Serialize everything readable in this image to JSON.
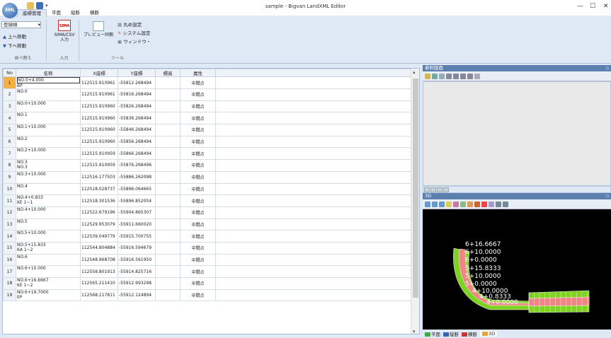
{
  "app": {
    "title": "sample - Bigvan LandXML Editor",
    "logo_text": "XML"
  },
  "menu_tabs": [
    "座標管理",
    "平面",
    "縦断",
    "横断"
  ],
  "ribbon": {
    "sort_combo": "登録順",
    "move_up": "上へ移動",
    "move_down": "下へ移動",
    "group_sort": "並べ替え",
    "sima_icon_text": "SIMA",
    "sima_csv_line1": "SIMA/CSV",
    "sima_csv_line2": "入力",
    "group_input": "入力",
    "preview_sync": "プレビュー同期",
    "circle_settings": "丸め設定",
    "system_settings": "システム設定",
    "window": "ウィンドウ・",
    "group_tools": "ツール"
  },
  "grid": {
    "headers": [
      "No",
      "名称",
      "X座標",
      "Y座標",
      "標高",
      "属性"
    ],
    "rows": [
      {
        "no": "1",
        "name1": "NO.0+4.000",
        "name2": "BP",
        "x": "112515.910961",
        "y": "-55812.268494",
        "z": "",
        "attr": "中間点"
      },
      {
        "no": "2",
        "name1": "NO.0",
        "name2": "",
        "x": "112515.910961",
        "y": "-55816.268494",
        "z": "",
        "attr": "中間点"
      },
      {
        "no": "3",
        "name1": "NO.0+10.000",
        "name2": "",
        "x": "112515.910960",
        "y": "-55826.268494",
        "z": "",
        "attr": "中間点"
      },
      {
        "no": "4",
        "name1": "NO.1",
        "name2": "",
        "x": "112515.910960",
        "y": "-55836.268494",
        "z": "",
        "attr": "中間点"
      },
      {
        "no": "5",
        "name1": "NO.1+10.000",
        "name2": "",
        "x": "112515.910960",
        "y": "-55846.268494",
        "z": "",
        "attr": "中間点"
      },
      {
        "no": "6",
        "name1": "NO.2",
        "name2": "",
        "x": "112515.910960",
        "y": "-55856.268494",
        "z": "",
        "attr": "中間点"
      },
      {
        "no": "7",
        "name1": "NO.2+10.000",
        "name2": "",
        "x": "112515.910959",
        "y": "-55866.268494",
        "z": "",
        "attr": "中間点"
      },
      {
        "no": "8",
        "name1": "NO.3",
        "name2": "NO.3",
        "x": "112515.910959",
        "y": "-55876.268496",
        "z": "",
        "attr": "中間点"
      },
      {
        "no": "9",
        "name1": "NO.3+10.000",
        "name2": "",
        "x": "112516.177503",
        "y": "-55886.262098",
        "z": "",
        "attr": "中間点"
      },
      {
        "no": "10",
        "name1": "NO.4",
        "name2": "",
        "x": "112518.028737",
        "y": "-55896.064665",
        "z": "",
        "attr": "中間点"
      },
      {
        "no": "11",
        "name1": "NO.4+0.833",
        "name2": "KE 1~1",
        "x": "112518.301536",
        "y": "-55896.852054",
        "z": "",
        "attr": "中間点"
      },
      {
        "no": "12",
        "name1": "NO.4+10.000",
        "name2": "",
        "x": "112522.679196",
        "y": "-55904.865307",
        "z": "",
        "attr": "中間点"
      },
      {
        "no": "13",
        "name1": "NO.5",
        "name2": "",
        "x": "112529.953079",
        "y": "-55911.660020",
        "z": "",
        "attr": "中間点"
      },
      {
        "no": "14",
        "name1": "NO.5+10.000",
        "name2": "",
        "x": "112539.049779",
        "y": "-55915.700755",
        "z": "",
        "attr": "中間点"
      },
      {
        "no": "15",
        "name1": "NO.5+15.833",
        "name2": "KA 1~2",
        "x": "112544.804884",
        "y": "-55916.594679",
        "z": "",
        "attr": "中間点"
      },
      {
        "no": "16",
        "name1": "NO.6",
        "name2": "",
        "x": "112548.968708",
        "y": "-55916.561950",
        "z": "",
        "attr": "中間点"
      },
      {
        "no": "17",
        "name1": "NO.6+10.000",
        "name2": "",
        "x": "112558.801913",
        "y": "-55914.825716",
        "z": "",
        "attr": "中間点"
      },
      {
        "no": "18",
        "name1": "NO.6+16.6667",
        "name2": "KE 1~2",
        "x": "112565.211410",
        "y": "-55912.993298",
        "z": "",
        "attr": "中間点"
      },
      {
        "no": "19",
        "name1": "NO.6+19.7000",
        "name2": "EP",
        "x": "112568.117811",
        "y": "-55912.124894",
        "z": "",
        "attr": "中間点"
      }
    ]
  },
  "ref_panel": {
    "title": "参照図面"
  },
  "view3d": {
    "title": "3D",
    "labels": [
      "6+16.6667",
      "6+10.0000",
      "6+0.0000",
      "5+15.8333",
      "5+10.0000",
      "5+0.0000",
      "4+10.0000",
      "4+0.8333",
      "4+0.0000"
    ]
  },
  "bottom_tabs": [
    "平面",
    "縦断",
    "横断",
    "3D"
  ]
}
